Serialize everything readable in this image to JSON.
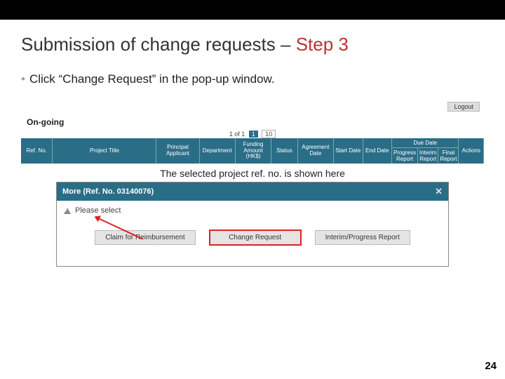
{
  "slide": {
    "title_main": "Submission of change requests – ",
    "title_accent": "Step 3",
    "bullet": "Click “Change Request” in the pop-up window.",
    "caption": "The selected project ref. no. is shown here",
    "page_number": "24"
  },
  "app": {
    "logout": "Logout",
    "section": "On-going",
    "pager_prefix": "1 of 1",
    "pager_page": "1",
    "pager_size": "10"
  },
  "headers": {
    "ref": "Ref. No.",
    "project_title": "Project Title",
    "principal": "Principal Applicant",
    "department": "Department",
    "funding": "Funding Amount (HK$)",
    "status": "Status",
    "agreement": "Agreement Date",
    "start": "Start Date",
    "end": "End Date",
    "due": "Due Date",
    "progress": "Progress Report",
    "interim": "Interim Report",
    "final": "Final Report",
    "actions": "Actions"
  },
  "popup": {
    "title": "More (Ref. No. 03140076)",
    "close": "✕",
    "please": "Please select",
    "buttons": {
      "claim": "Claim for Reimbursement",
      "change": "Change Request",
      "interim": "Interim/Progress Report"
    }
  }
}
